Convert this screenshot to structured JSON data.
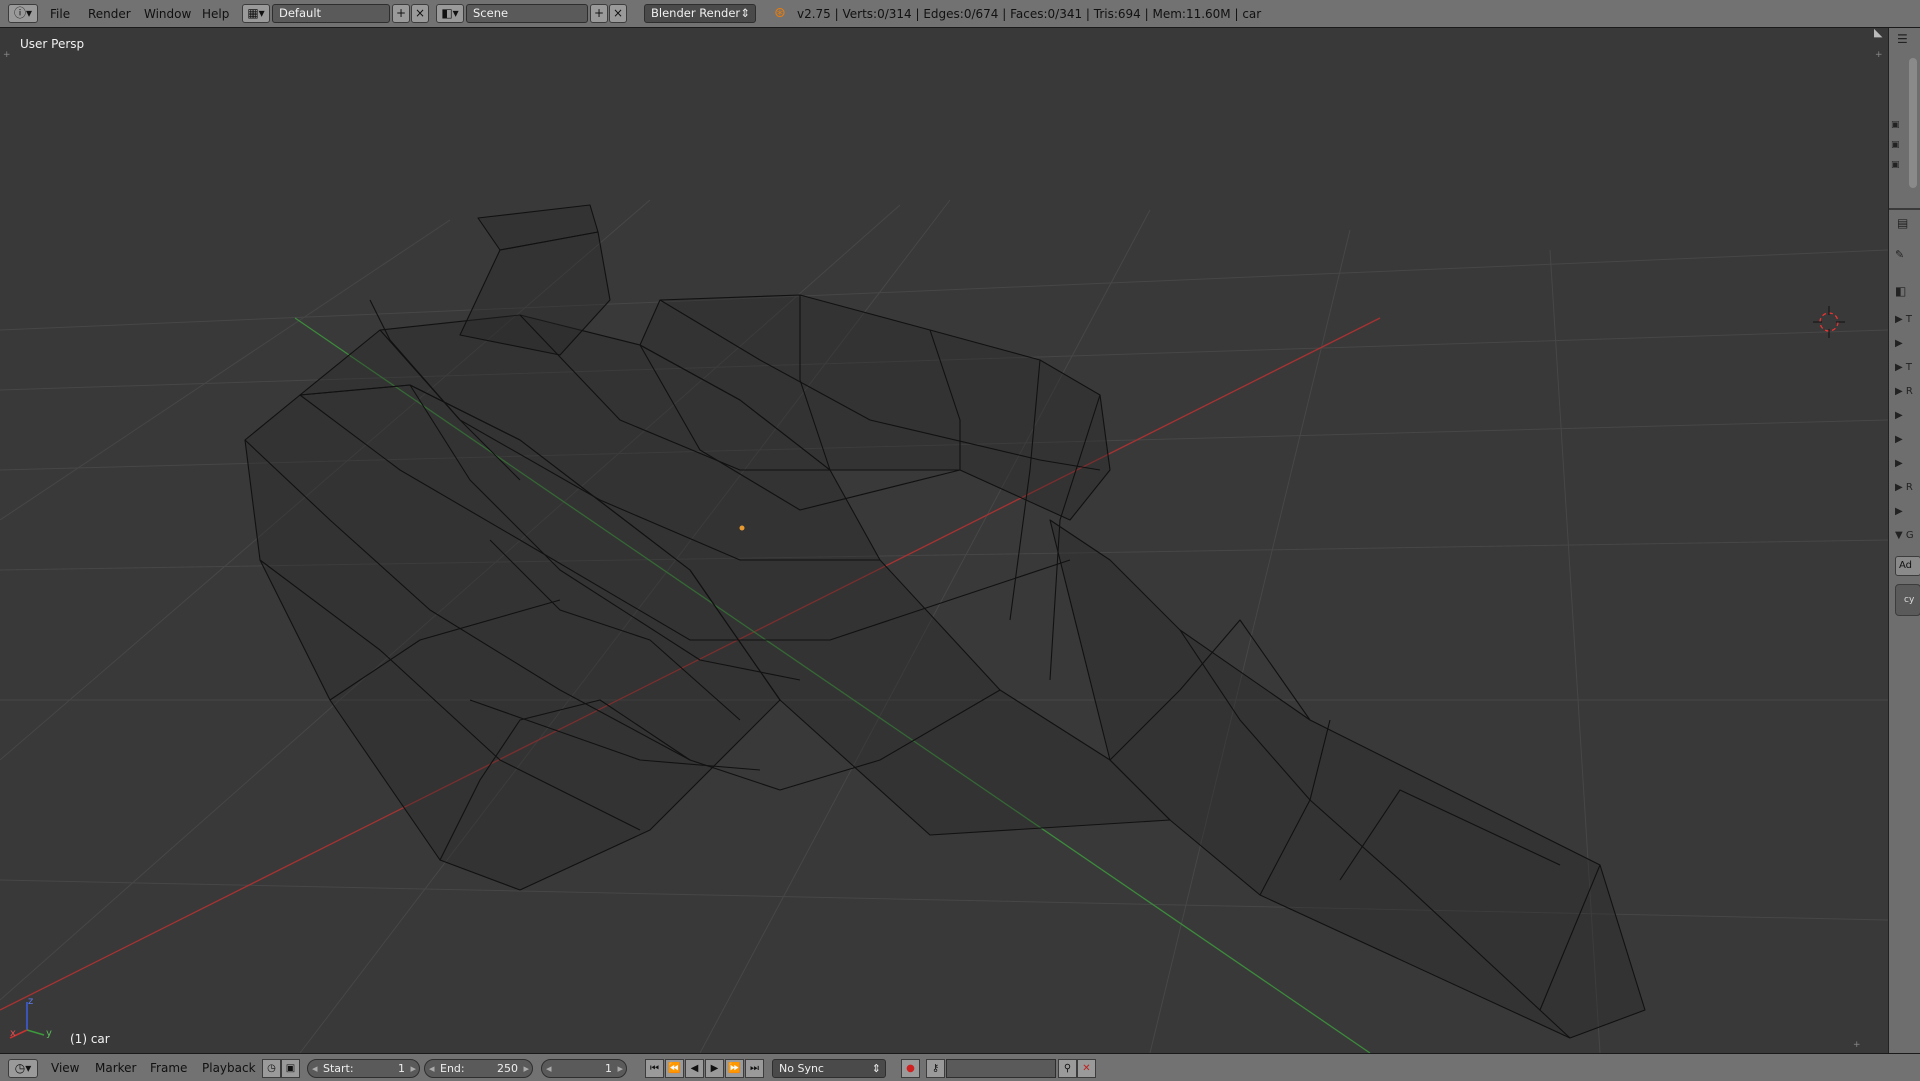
{
  "topbar": {
    "menus": [
      "File",
      "Render",
      "Window",
      "Help"
    ],
    "layout": "Default",
    "scene": "Scene",
    "render_engine": "Blender Render",
    "stats": "v2.75 | Verts:0/314 | Edges:0/674 | Faces:0/341 | Tris:694 | Mem:11.60M | car"
  },
  "viewport": {
    "view_name": "User Persp",
    "active_object": "(1) car",
    "axis_labels": {
      "x": "x",
      "y": "y",
      "z": "z"
    }
  },
  "right_panel": {
    "rows": [
      "T",
      "",
      "T",
      "R",
      "",
      "",
      "",
      "R",
      "",
      "G"
    ],
    "add_button": "Ad",
    "field": "cy"
  },
  "timeline": {
    "menus": [
      "View",
      "Marker",
      "Frame",
      "Playback"
    ],
    "start_label": "Start:",
    "start_value": "1",
    "end_label": "End:",
    "end_value": "250",
    "current_frame": "1",
    "sync": "No Sync"
  },
  "colors": {
    "header": "#727272",
    "viewport": "#393939",
    "x_axis": "#a83232",
    "y_axis": "#3c8a3c",
    "wire": "#111111"
  }
}
